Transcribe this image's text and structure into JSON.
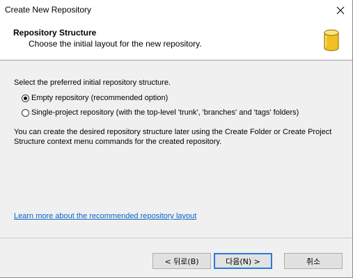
{
  "window": {
    "title": "Create New Repository"
  },
  "header": {
    "title": "Repository Structure",
    "subtitle": "Choose the initial layout for the new repository."
  },
  "main": {
    "prompt": "Select the preferred initial repository structure.",
    "options": [
      {
        "label": "Empty repository (recommended option)",
        "selected": true
      },
      {
        "label": "Single-project repository (with the top-level 'trunk', 'branches' and 'tags' folders)",
        "selected": false
      }
    ],
    "info": "You can create the desired repository structure later using the Create Folder or Create Project Structure context menu commands for the created repository.",
    "link": "Learn more about the recommended repository layout"
  },
  "buttons": {
    "back": "< 뒤로(B)",
    "next": "다음(N) >",
    "cancel": "취소"
  },
  "icons": {
    "close": "close-icon",
    "header": "database-icon"
  },
  "colors": {
    "link": "#0b63c6",
    "default_button_border": "#2a7ad6",
    "database": "#f0c020"
  }
}
